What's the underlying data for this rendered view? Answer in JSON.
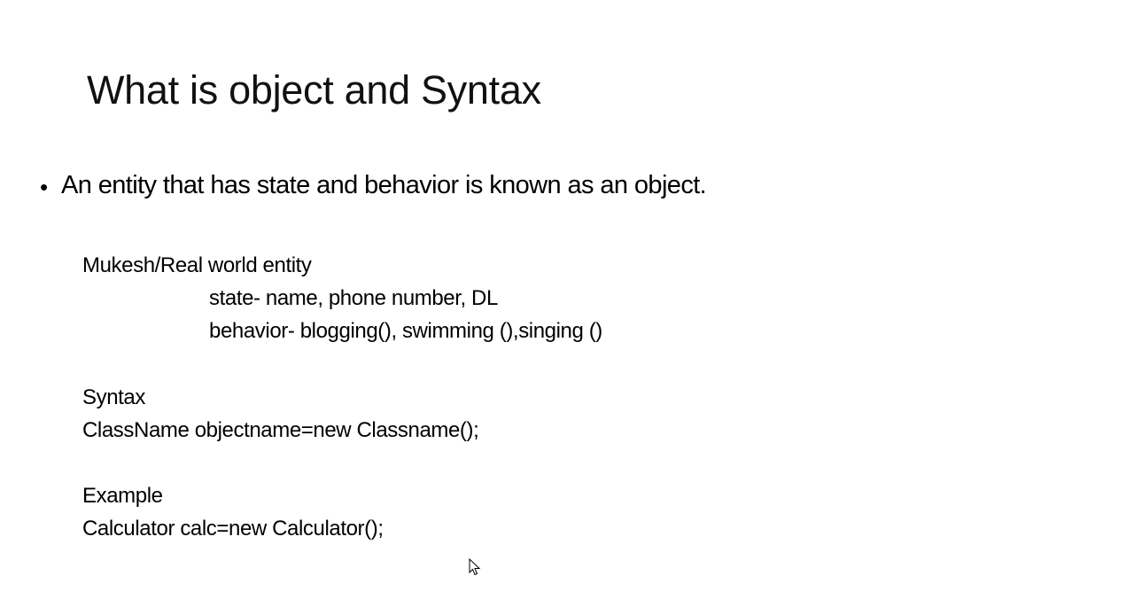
{
  "slide": {
    "title": "What is object and Syntax",
    "bullet": "An entity that has state and behavior is known as an object.",
    "example_entity": {
      "heading": "Mukesh/Real world entity",
      "state": "state- name, phone number, DL",
      "behavior": "behavior- blogging(), swimming (),singing ()"
    },
    "syntax": {
      "heading": "Syntax",
      "code": "ClassName objectname=new Classname();"
    },
    "example": {
      "heading": "Example",
      "code": "Calculator calc=new Calculator();"
    }
  },
  "icons": {
    "cursor": "mouse-pointer-icon"
  }
}
